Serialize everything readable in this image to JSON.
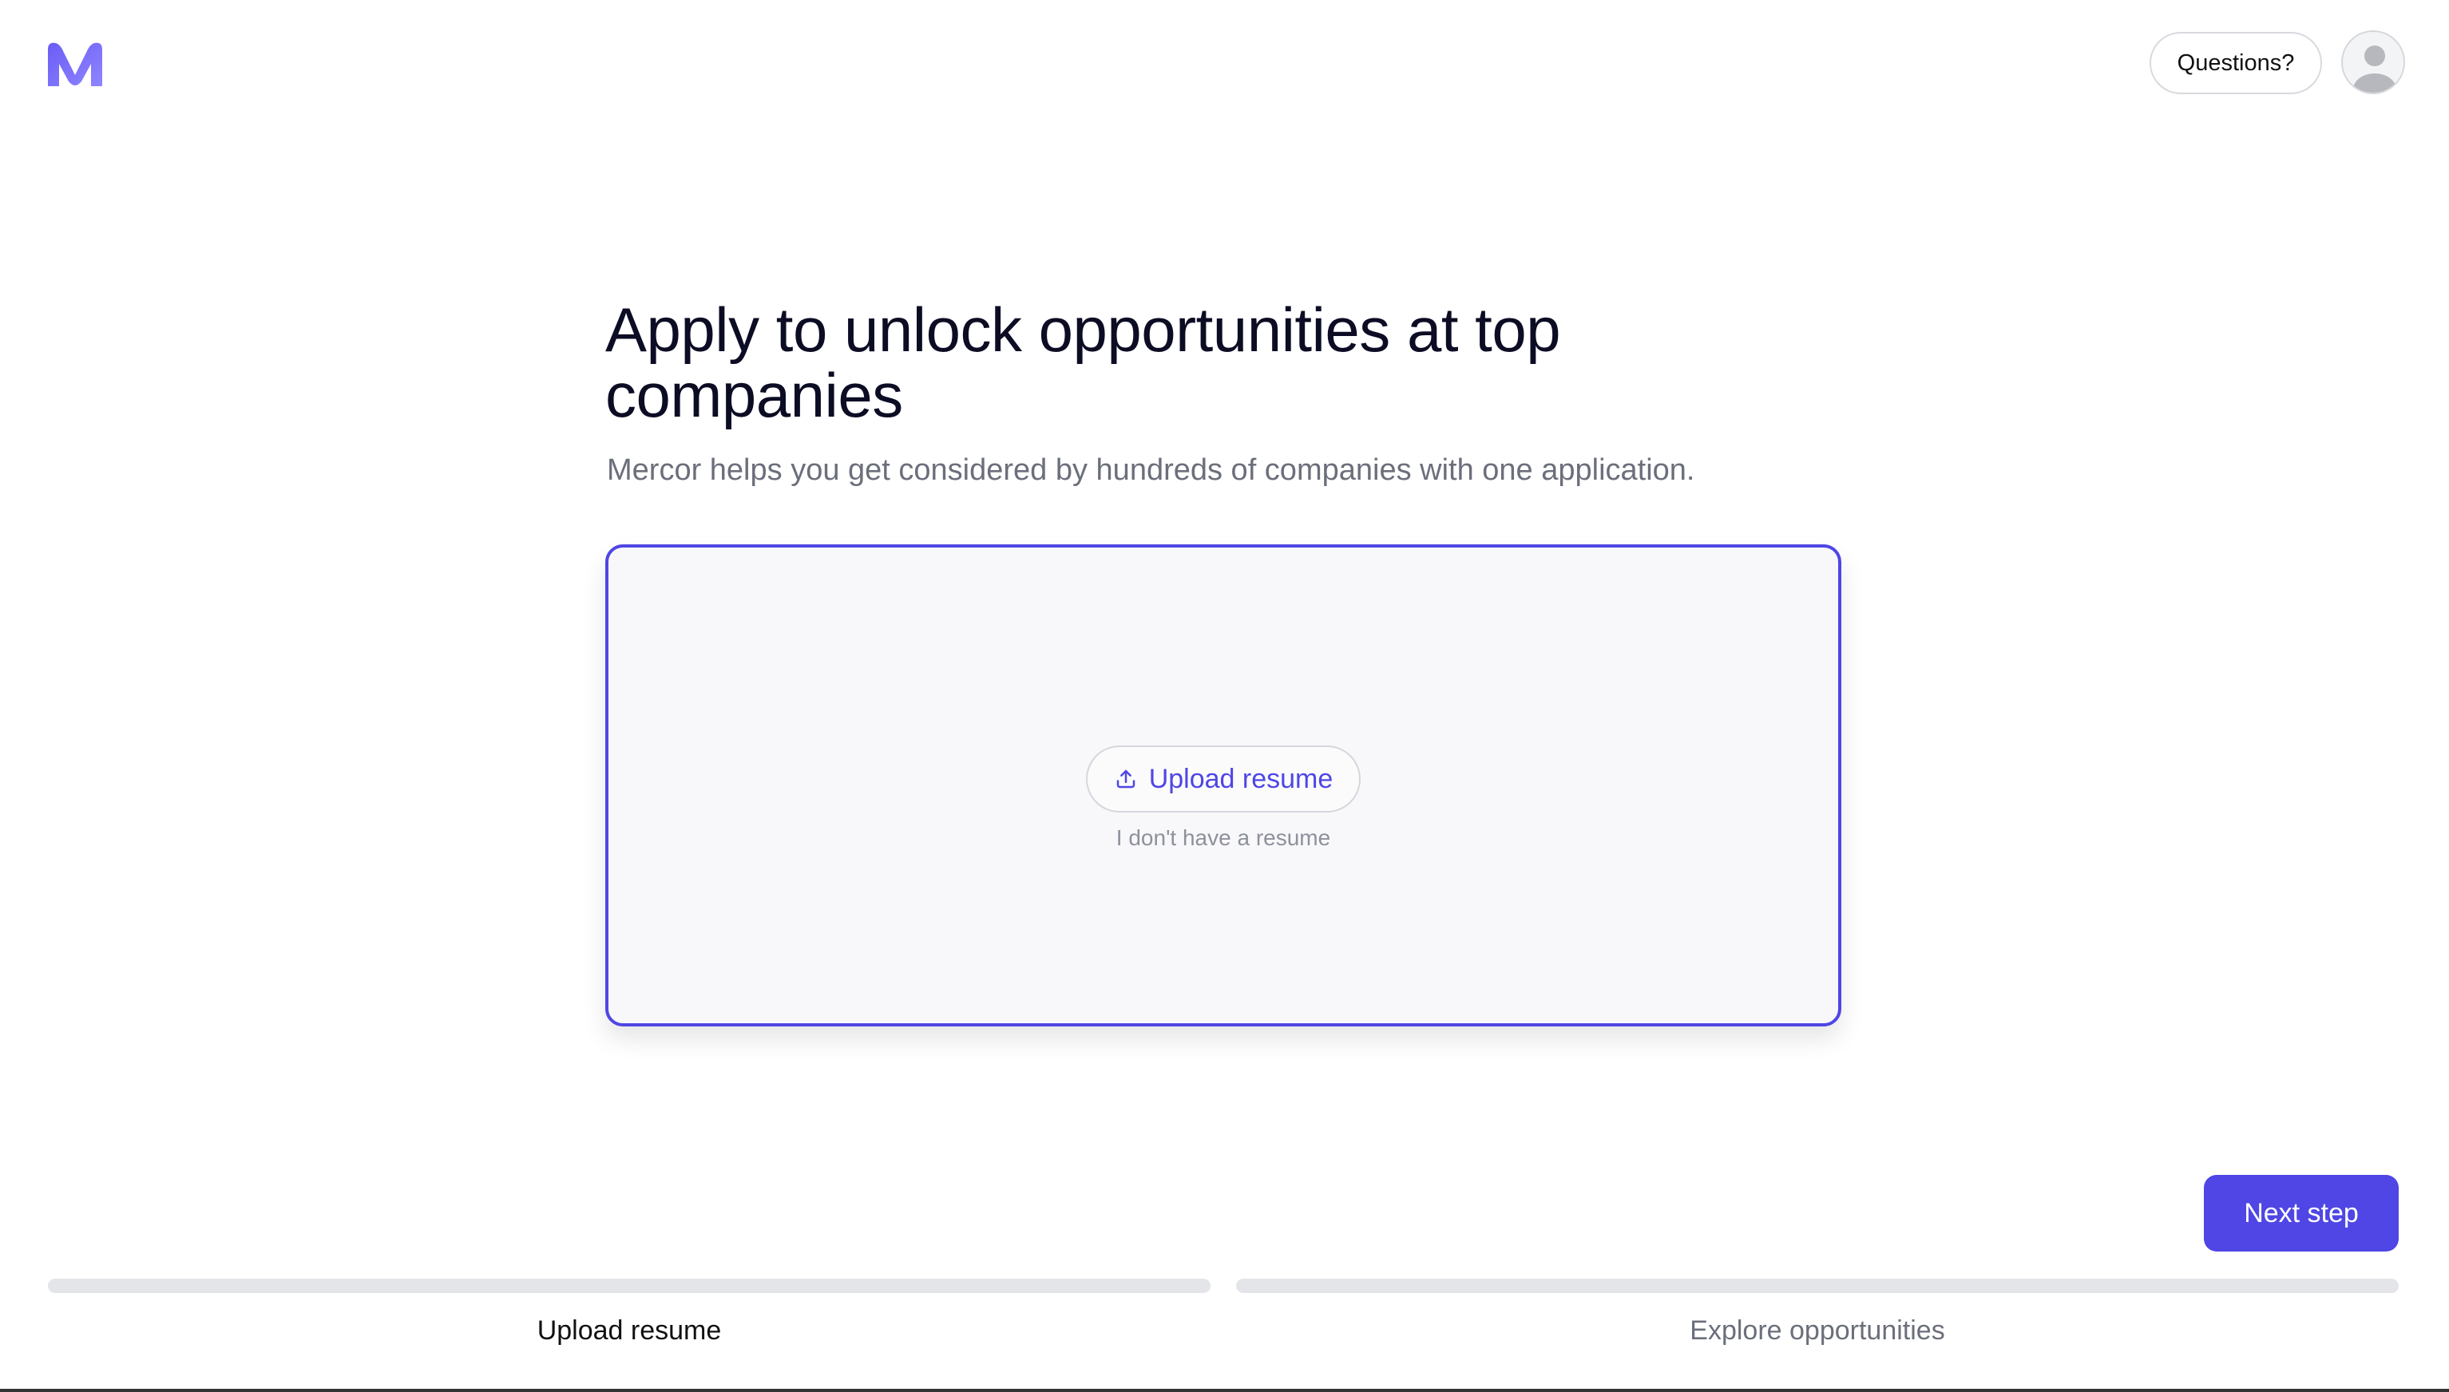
{
  "header": {
    "logo_icon": "mercor-m-logo",
    "questions_label": "Questions?",
    "avatar_icon": "user-avatar-icon"
  },
  "main": {
    "title": "Apply to unlock opportunities at top companies",
    "subtitle": "Mercor helps you get considered by hundreds of companies with one application.",
    "upload_button_label": "Upload resume",
    "upload_icon": "upload-icon",
    "no_resume_link": "I don't have a resume",
    "next_button_label": "Next step"
  },
  "progress": {
    "steps": [
      {
        "label": "Upload resume",
        "progress": 0
      },
      {
        "label": "Explore opportunities",
        "progress": 0
      }
    ]
  },
  "colors": {
    "accent": "#4f46e5",
    "progress_track": "#e4e5e9",
    "muted_text": "#6b6f7b"
  }
}
